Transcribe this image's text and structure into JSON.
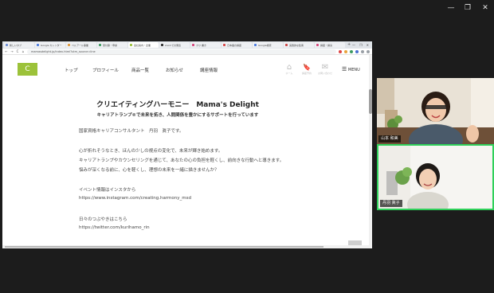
{
  "browser": {
    "tabs": [
      {
        "label": "新しいタブ",
        "favicon": "#6b8cd6"
      },
      {
        "label": "Google カレンダー",
        "favicon": "#4a7be0"
      },
      {
        "label": "ベルアール事業",
        "favicon": "#e09a3b"
      },
      {
        "label": "受付票・申請",
        "favicon": "#3c9a5f"
      },
      {
        "label": "会社案内・企業",
        "favicon": "#9cc23a",
        "active": true
      },
      {
        "label": "zoomでの発表",
        "favicon": "#2d2d2d"
      },
      {
        "label": "カワ 書き",
        "favicon": "#d6447a"
      },
      {
        "label": "日本語の講座",
        "favicon": "#d64444"
      },
      {
        "label": "Google検索",
        "favicon": "#4a7be0"
      },
      {
        "label": "実践的な集客",
        "favicon": "#c44"
      },
      {
        "label": "講座・講演",
        "favicon": "#d6447a"
      }
    ],
    "url": "mamasdelight.jp/index.html?utm_source=line",
    "nav": {
      "back": "←",
      "forward": "→",
      "reload": "C",
      "home": "⌂"
    }
  },
  "site": {
    "logo_glyph": "C",
    "menu": [
      "トップ",
      "プロフィール",
      "商品一覧",
      "お知らせ",
      "講座情報"
    ],
    "icons": [
      {
        "name": "home-icon",
        "glyph": "⌂",
        "caption": "ホーム"
      },
      {
        "name": "bookmark-icon",
        "glyph": "🔖",
        "caption": "講座予約"
      },
      {
        "name": "mail-icon",
        "glyph": "✉",
        "caption": "お問い合わせ"
      }
    ],
    "menu_button": "MENU",
    "title": "クリエイティングハーモニー　Mama's Delight",
    "subtitle": "キャリアトランプ®で未来を拓き、人間関係を豊かにするサポートを行っています",
    "body": [
      "国家資格キャリアコンサルタント　丹羽　眞子です。",
      "心が折れそうなとき、ほんの少しの視点の変化で、未来が輝き始めます。",
      "キャリアトランプやカウンセリングを通じて、あなたの心の負担を軽くし、前向きな行動へと導きます。",
      "悩みが深くなる前に、心を軽くし、理想の未来を一緒に描きませんか？",
      "イベント情報はインスタから",
      "https://www.instagram.com/creating.harmony_msd",
      "日々のつぶやきはこちら",
      "https://twitter.com/kurihamo_rin"
    ],
    "back_to_top": "∧"
  },
  "participants": [
    {
      "name": "山本 和美"
    },
    {
      "name": "丹羽 眞子"
    }
  ],
  "window_controls": {
    "minimize": "—",
    "restore": "❐",
    "close": "✕"
  }
}
